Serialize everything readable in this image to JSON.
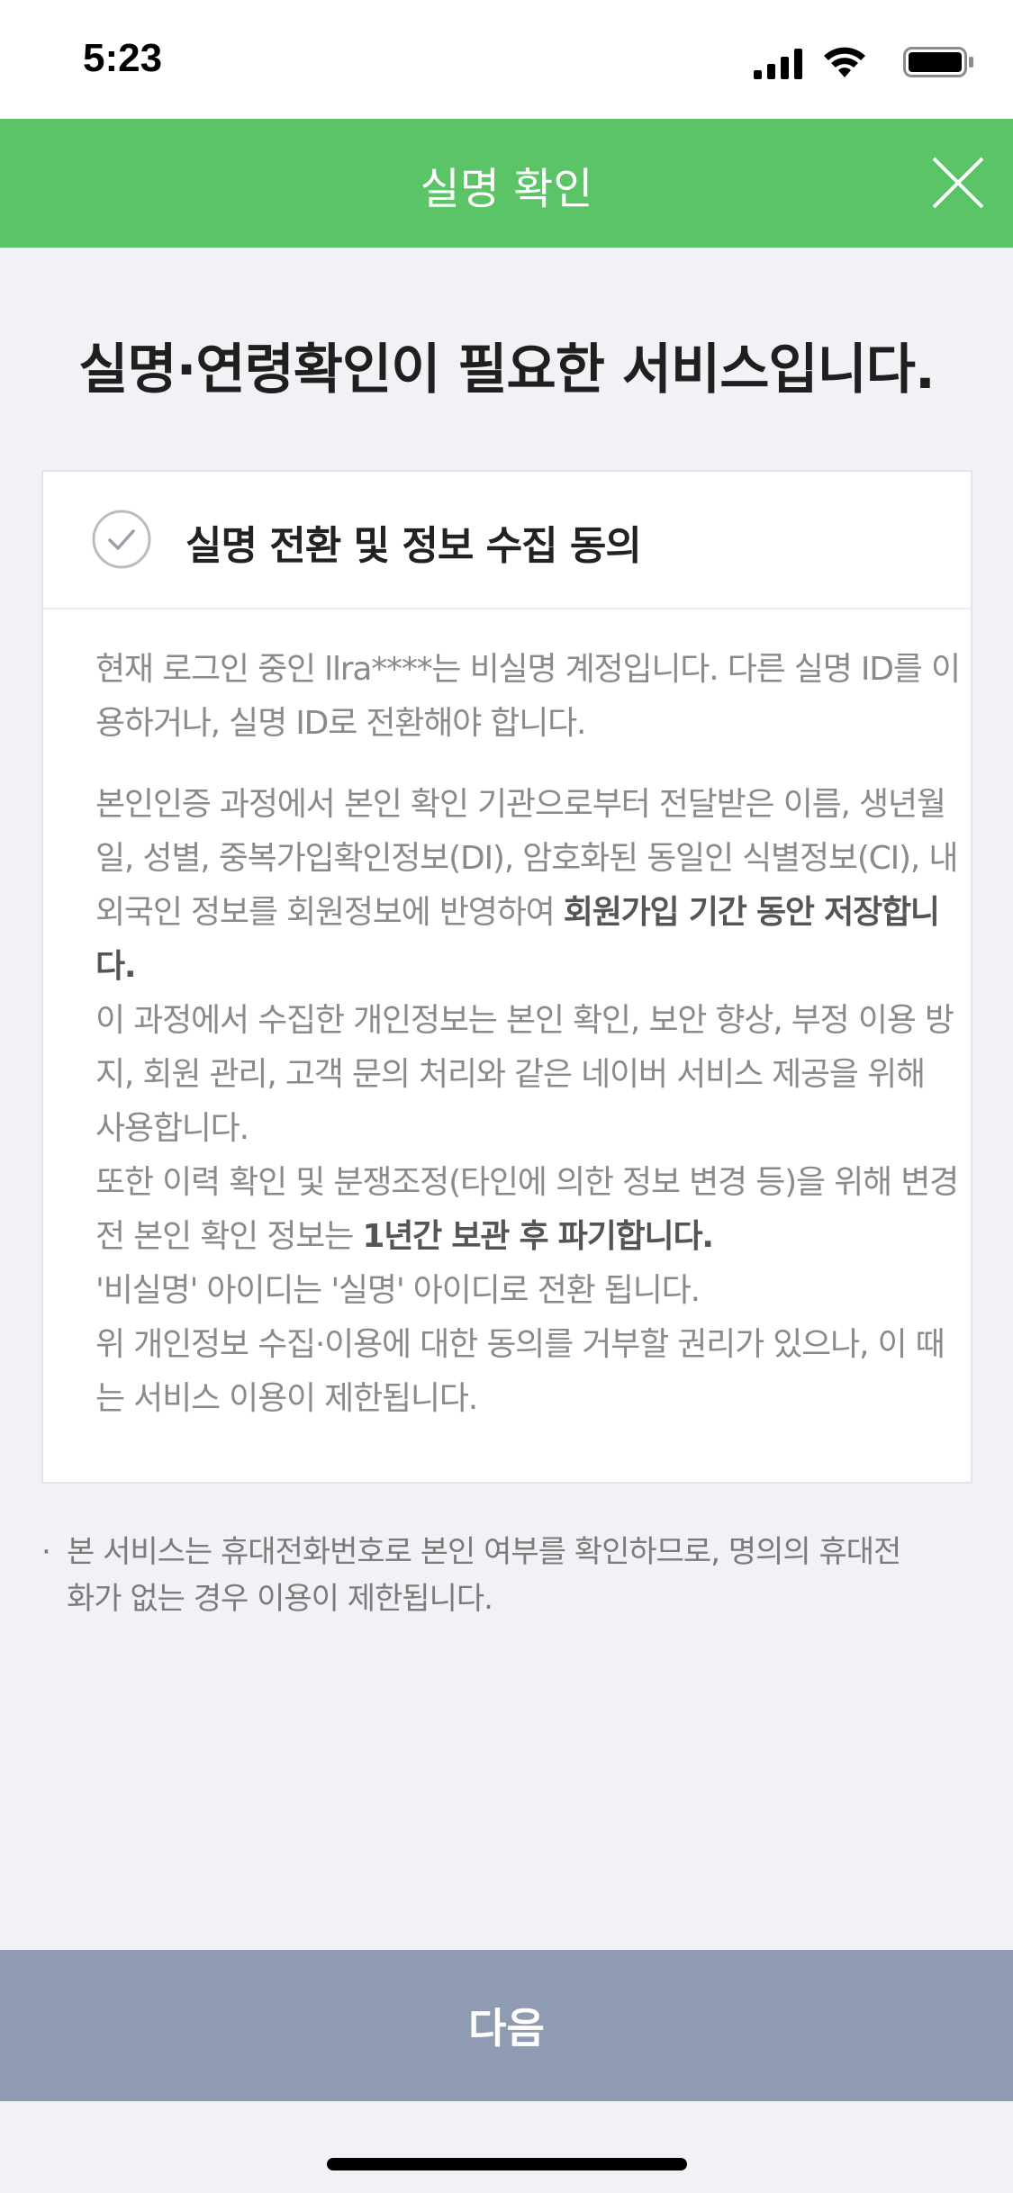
{
  "status_bar": {
    "time": "5:23"
  },
  "header": {
    "title": "실명 확인"
  },
  "main": {
    "heading": "실명·연령확인이 필요한 서비스입니다."
  },
  "card": {
    "agree_label": "실명 전환 및 정보 수집 동의",
    "paragraph1": "현재 로그인 중인 llra****는 비실명 계정입니다. 다른 실명 ID를 이용하거나, 실명 ID로 전환해야 합니다.",
    "p2_text": "본인인증 과정에서 본인 확인 기관으로부터 전달받은 이름, 생년월일, 성별, 중복가입확인정보(DI), 암호화된 동일인 식별정보(CI), 내외국인 정보를 회원정보에 반영하여 ",
    "p2_bold": "회원가입 기간 동안 저장합니다.",
    "p3": "이 과정에서 수집한 개인정보는 본인 확인, 보안 향상, 부정 이용 방지, 회원 관리, 고객 문의 처리와 같은 네이버 서비스 제공을 위해 사용합니다.",
    "p4_text": "또한 이력 확인 및 분쟁조정(타인에 의한 정보 변경 등)을 위해 변경 전 본인 확인 정보는 ",
    "p4_bold": "1년간 보관 후 파기합니다.",
    "p5": "'비실명' 아이디는 '실명' 아이디로 전환 됩니다.",
    "p6": "위 개인정보 수집·이용에 대한 동의를 거부할 권리가 있으나, 이 때는 서비스 이용이 제한됩니다."
  },
  "notice": {
    "bullet": "·",
    "text": "본 서비스는 휴대전화번호로 본인 여부를 확인하므로, 명의의 휴대전화가 없는 경우 이용이 제한됩니다."
  },
  "footer": {
    "next_label": "다음"
  },
  "colors": {
    "header_bg": "#5ac466",
    "button_bg": "#8e9bb2",
    "page_bg": "#f1f2f6"
  },
  "icons": [
    "signal-icon",
    "wifi-icon",
    "battery-icon",
    "close-icon",
    "check-circle-icon"
  ]
}
